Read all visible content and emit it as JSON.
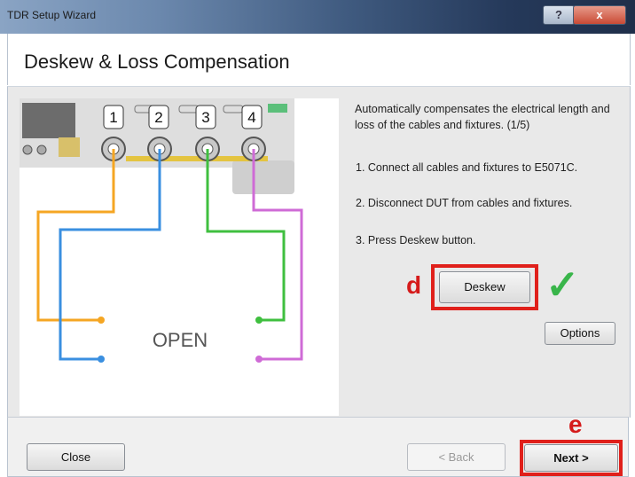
{
  "window": {
    "title": "TDR Setup Wizard",
    "help_glyph": "?",
    "close_glyph": "x"
  },
  "header": {
    "title": "Deskew & Loss Compensation"
  },
  "diagram": {
    "ports": [
      "1",
      "2",
      "3",
      "4"
    ],
    "open_label": "OPEN",
    "cable_colors": {
      "1": "#f5a623",
      "2": "#3a8fe0",
      "3": "#3fbf3f",
      "4": "#cf6bd6"
    }
  },
  "instructions": {
    "description": "Automatically compensates the electrical length and loss of the cables and fixtures.  (1/5)",
    "steps": [
      "1. Connect all cables and fixtures to E5071C.",
      "2. Disconnect DUT from cables and fixtures.",
      "3. Press Deskew button."
    ]
  },
  "annotations": {
    "d": "d",
    "e": "e",
    "check": "✓"
  },
  "buttons": {
    "deskew": "Deskew",
    "options": "Options",
    "close": "Close",
    "back": "< Back",
    "next": "Next >"
  }
}
